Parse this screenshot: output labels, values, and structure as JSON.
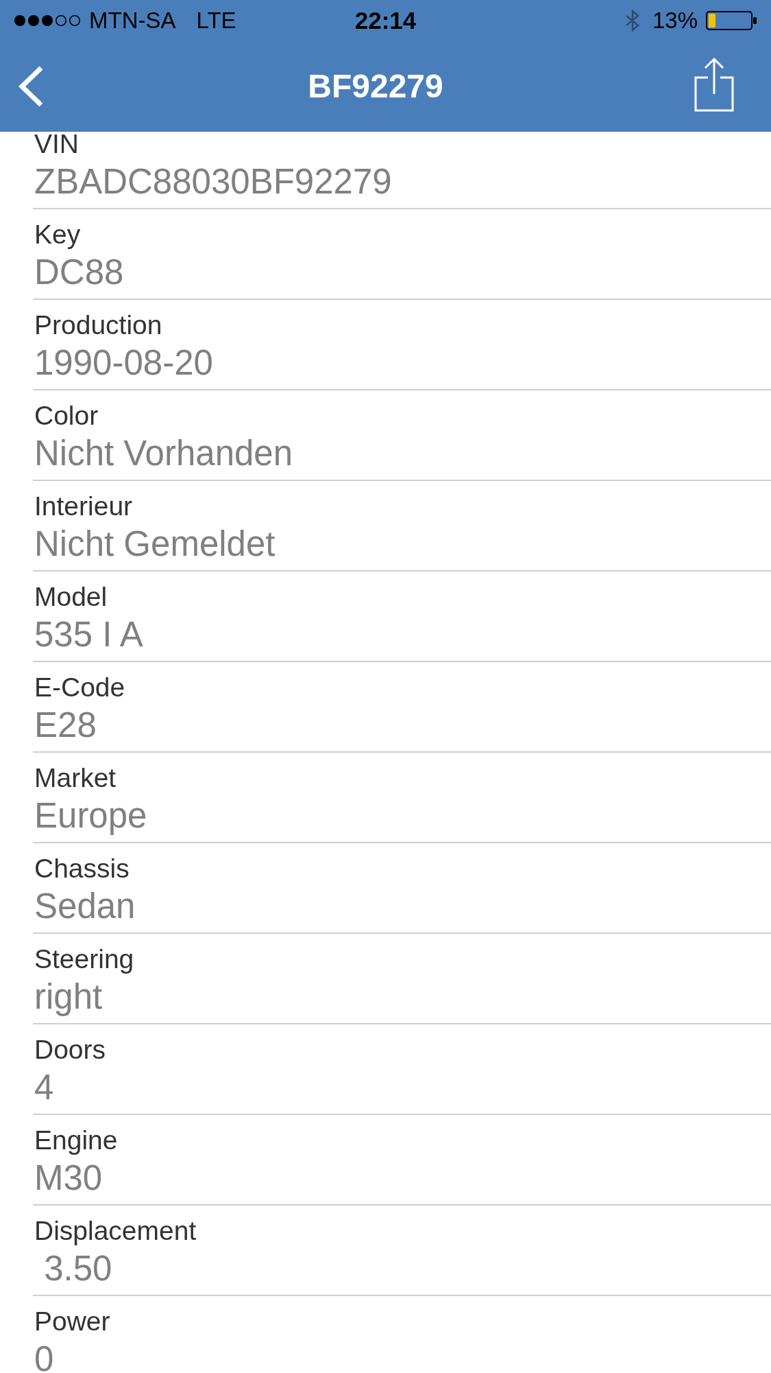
{
  "status_bar": {
    "carrier": "MTN-SA",
    "network": "LTE",
    "time": "22:14",
    "battery": "13%"
  },
  "nav_bar": {
    "title": "BF92279"
  },
  "fields": [
    {
      "label": "VIN",
      "value": "ZBADC88030BF92279"
    },
    {
      "label": "Key",
      "value": "DC88"
    },
    {
      "label": "Production",
      "value": "1990-08-20"
    },
    {
      "label": "Color",
      "value": "Nicht Vorhanden"
    },
    {
      "label": "Interieur",
      "value": "Nicht Gemeldet"
    },
    {
      "label": "Model",
      "value": "535 I A"
    },
    {
      "label": "E-Code",
      "value": "E28"
    },
    {
      "label": "Market",
      "value": "Europe"
    },
    {
      "label": "Chassis",
      "value": "Sedan"
    },
    {
      "label": "Steering",
      "value": "right"
    },
    {
      "label": "Doors",
      "value": "4"
    },
    {
      "label": "Engine",
      "value": "M30"
    },
    {
      "label": "Displacement",
      "value": " 3.50"
    },
    {
      "label": "Power",
      "value": "0"
    }
  ]
}
